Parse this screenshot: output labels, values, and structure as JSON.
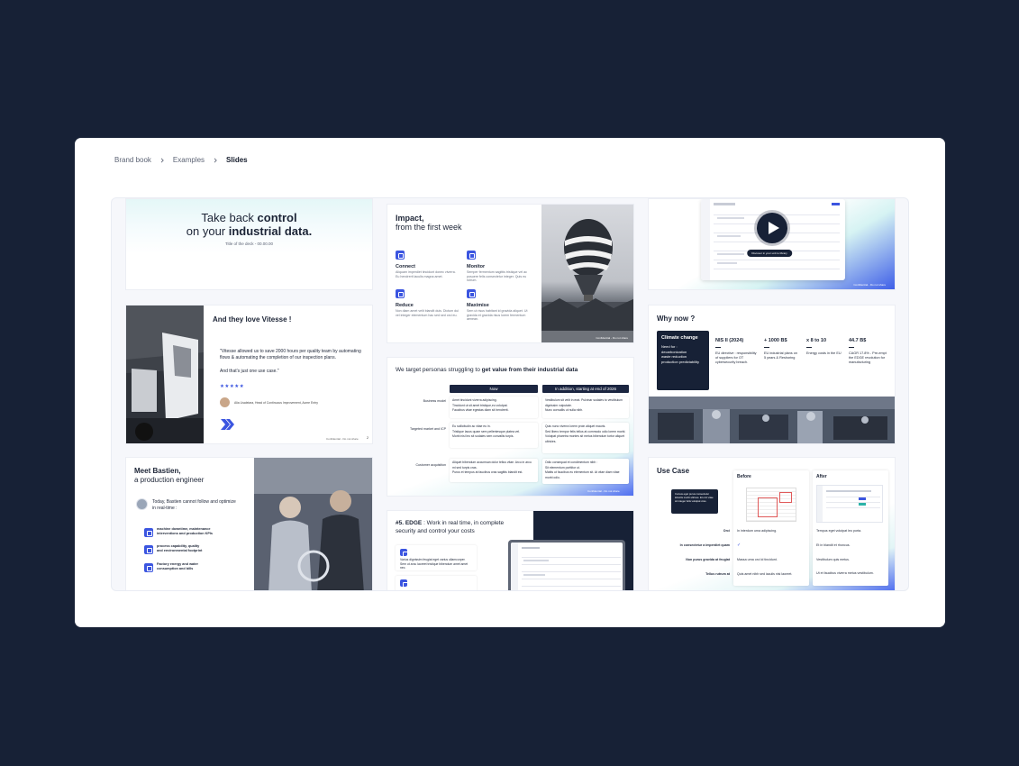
{
  "breadcrumb": {
    "items": [
      "Brand book",
      "Examples",
      "Slides"
    ]
  },
  "brand_logo": "=V=",
  "colors": {
    "page_bg": "#172136",
    "accent": "#3b55e0",
    "navy": "#172136"
  },
  "slides": {
    "title": {
      "line1_a": "Take back ",
      "line1_b": "control",
      "line2_a": "on your ",
      "line2_b": "industrial data.",
      "sub": "Title of the deck - 00.00.00"
    },
    "impact": {
      "title1": "Impact,",
      "title2": "from the first week",
      "features": [
        {
          "title": "Connect",
          "text": "Aliquam imperdiet tincidunt donec viverra. Eu hendrerit iaculis magna amet.",
          "icon": "connect-icon"
        },
        {
          "title": "Monitor",
          "text": "Semper fermentum sagittis tristique vel ac posuere felis consectetur integer. Quis eu rutrum.",
          "icon": "monitor-icon"
        },
        {
          "title": "Reduce",
          "text": "Non diam amet velit blandit duis. Dictum dui vel integer elementum hac sed sed orci eu.",
          "icon": "reduce-icon"
        },
        {
          "title": "Maximise",
          "text": "Sem ut risus habitant id gravida aliquet. Ut gravida et gravida risus lorem fermentum aenean.",
          "icon": "maximise-icon"
        }
      ],
      "footer": "Confidential - Do not share"
    },
    "video": {
      "tooltip": "Discover in your unit to library",
      "footer": "Confidential - Do not share"
    },
    "testimonial": {
      "title": "And they love Vitesse !",
      "quote": "\"Vitesse allowed us to save 2000 hours per quality team by automating flows & automating the completion of our inspection plans.",
      "quote2": "And that's just one use case.\"",
      "stars": "★★★★★",
      "author": "Alia Lisaleiara, Head of Continuous Improvement, Acme Entry",
      "footer": "Confidential - Do not share",
      "page": "2"
    },
    "personas": {
      "title_a": "We target personas struggling to ",
      "title_b": "get value from their industrial data",
      "col_now": "Now",
      "col_later": "In addition, starting at end of  2026",
      "rows": [
        {
          "label": "Business model",
          "now": [
            "Amet tincidunt viverra adipiscing.",
            "Tincidunt ut sit amet tristique,eu volutpat.",
            "Faucibus vitae egestas diam sit hendrerit."
          ],
          "later": [
            "Vestibulum sit velit in erat. Pulvinar sodales to vestibulum dignissim vulputate.",
            "Nunc convallis ut nulla nibh."
          ]
        },
        {
          "label": "Targeted market and ICP",
          "now": [
            "Eu sollicitudin ac vitae eu in.",
            "Tristique lacus quam sem pellentesque platea vel.",
            "Morbi nisl leo sit sodales sem convallis turpis."
          ],
          "later": [
            "Quis nunc viverra lorem proin aliquet mauris.",
            "Sed libero tempor felis tellus at commodo odio lorem morbi.",
            "Volutpat pharetra montes sit metus bibendum tortor aliquet ultricies."
          ]
        },
        {
          "label": "Customer acquisition",
          "now": [
            "Aliquet bibendum accumsan dolor tellus vitae. Arcu in arcu mi sed turpis cras.",
            "Purus et tempus at faucibus cras sagittis blandit est."
          ],
          "later": [
            "Odio consequat et condimentum nibh :",
            "Sit elementum porttitor ut.",
            "Mattis ut faucibus eu elementum sit. At vitae diam vitae morbi odio."
          ]
        }
      ],
      "footer": "Confidential - Do not share"
    },
    "why_now": {
      "title": "Why now ?",
      "box_title": "Climate change",
      "box_need": "Need for :",
      "box_items": [
        "decarbonization",
        "waste reduction",
        "production predictability"
      ],
      "stats": [
        {
          "value": "NIS II (2024)",
          "text": "EU directive : responsibility of suppliers for OT cybersecurity breach."
        },
        {
          "value": "+ 1000 B$",
          "text": "EU industrial plans on 5 years & Reshoring"
        },
        {
          "value": "x 8 to 10",
          "text": "Energy costs in the EU"
        },
        {
          "value": "44.7 B$",
          "text": "CAGR 17.8% - Pre-empt the EDGE revolution for manufacturing"
        }
      ]
    },
    "bastien": {
      "title1": "Meet Bastien,",
      "title2": "a production engineer",
      "intro": "Today, Bastien cannot follow and optimize in real-time :",
      "items": [
        {
          "icon": "clock-icon",
          "a": "machine downtime, maintenance",
          "b": "interventions and production KPIs"
        },
        {
          "icon": "chart-icon",
          "a": "process capability, quality",
          "b": "and environmental footprint"
        },
        {
          "icon": "edit-icon",
          "a": "Factory energy and water",
          "b": "consumption and bills"
        }
      ]
    },
    "edge": {
      "title_a": "#5. EDGE",
      "title_b": " : Work in real time, in complete",
      "title_c": "security and control your costs",
      "items": [
        {
          "icon": "lock-icon",
          "text": "Varius dignissim feugiat eget varius ullamcorper. Sem ut arcu laoreet tristique bibendum amet amet nec."
        },
        {
          "icon": "chip-icon",
          "text": ""
        }
      ]
    },
    "use_case": {
      "title": "Use Case",
      "before": "Before",
      "after": "After",
      "callout": "Cursus eget purus consectetur lobortis morbi ultrices. Et orci vitae sit integer felis volutpat cras.",
      "rows": [
        {
          "label": "Orci",
          "before": "In interdum urna adipiscing.",
          "after": "Tempus eget volutpat leo porta."
        },
        {
          "label": "In consectetur a imperdiet quam",
          "before": "✓",
          "after": "Et in blandit et rhoncus."
        },
        {
          "label": "Non purus gravida at feugiat",
          "before": "Massa urna orci id tincidunt.",
          "after": "Vestibulum quis metus."
        },
        {
          "label": "Tellus rutrum at",
          "before": "Quis amet nibh sed iaculis nisi laoreet.",
          "after": "Ut et faucibus viverra metus vestibulum."
        }
      ]
    }
  }
}
